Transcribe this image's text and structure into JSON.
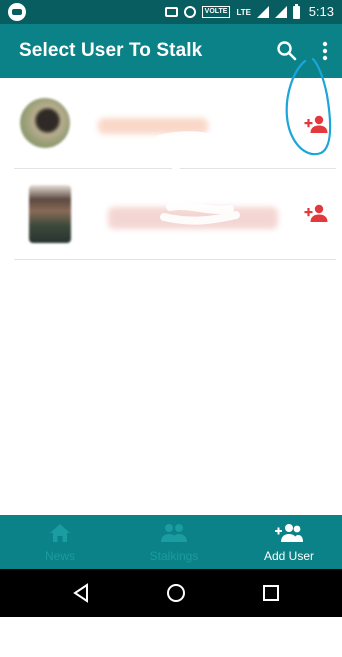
{
  "status_bar": {
    "time": "5:13",
    "icons": [
      "app-notification-icon",
      "cast-icon",
      "alarm-icon",
      "volte-icon",
      "lte-icon",
      "signal-icon",
      "signal-icon",
      "battery-icon"
    ],
    "volte_label": "VOLTE",
    "lte_label": "LTE"
  },
  "app_bar": {
    "title": "Select User To Stalk",
    "actions": [
      "search-icon",
      "more-vert-icon"
    ]
  },
  "users": [
    {
      "name": "",
      "action_icon": "person-add-icon"
    },
    {
      "name": "",
      "action_icon": "person-add-icon"
    }
  ],
  "bottom_nav": {
    "items": [
      {
        "label": "News",
        "icon": "home-icon",
        "active": false
      },
      {
        "label": "Stalkings",
        "icon": "people-icon",
        "active": false
      },
      {
        "label": "Add User",
        "icon": "person-add-group-icon",
        "active": true
      }
    ]
  },
  "system_nav": [
    "back-icon",
    "home-circle-icon",
    "recents-icon"
  ],
  "colors": {
    "status_bar": "#075d5f",
    "primary": "#0b8287",
    "accent": "#e4393c",
    "nav_inactive": "#1a9ca0",
    "annotation": "#1ba5d8"
  }
}
